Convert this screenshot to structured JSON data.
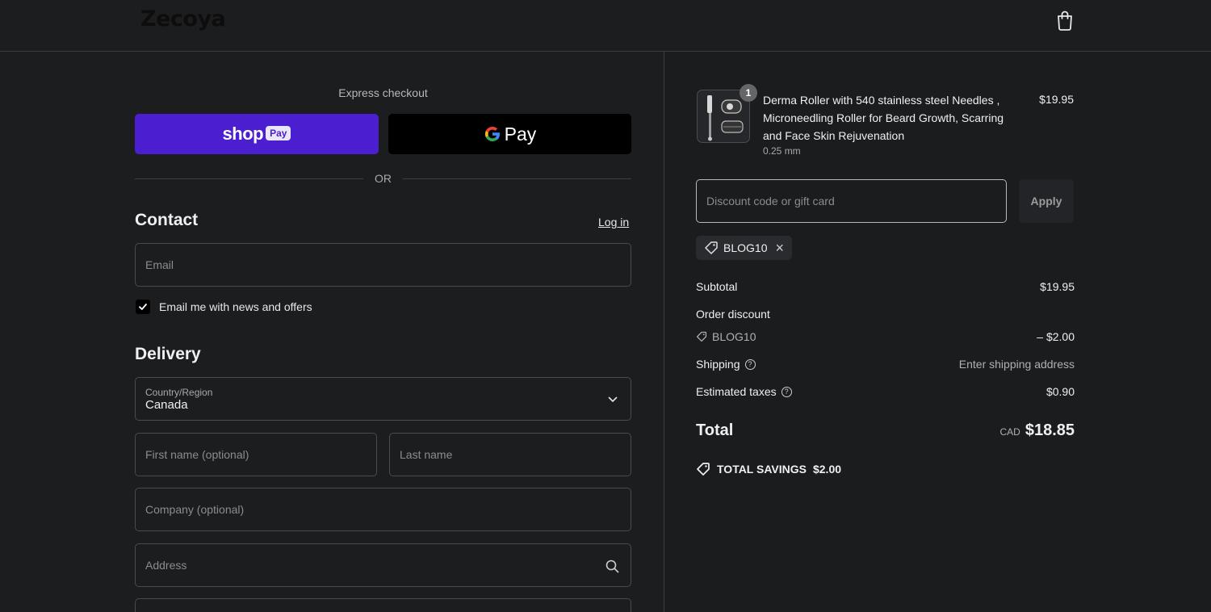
{
  "header": {
    "logo": "Zecoya",
    "cart_icon": "shopping-bag-icon"
  },
  "express": {
    "label": "Express checkout",
    "shop_pay_text": "shop",
    "shop_pay_pill": "Pay",
    "google_pay_text": "Pay",
    "or_text": "OR"
  },
  "contact": {
    "title": "Contact",
    "login_label": "Log in",
    "email_placeholder": "Email",
    "newsletter_label": "Email me with news and offers",
    "newsletter_checked": true
  },
  "delivery": {
    "title": "Delivery",
    "country_label": "Country/Region",
    "country_value": "Canada",
    "first_name_placeholder": "First name (optional)",
    "last_name_placeholder": "Last name",
    "company_placeholder": "Company (optional)",
    "address_placeholder": "Address"
  },
  "cart": {
    "item": {
      "quantity": "1",
      "title": "Derma Roller with 540 stainless steel Needles , Microneedling Roller for Beard Growth, Scarring and Face Skin Rejuvenation",
      "variant": "0.25 mm",
      "price": "$19.95"
    },
    "discount_placeholder": "Discount code or gift card",
    "apply_label": "Apply",
    "applied_code": "BLOG10",
    "subtotal_label": "Subtotal",
    "subtotal_value": "$19.95",
    "order_discount_label": "Order discount",
    "discount_code": "BLOG10",
    "discount_value": "– $2.00",
    "shipping_label": "Shipping",
    "shipping_value": "Enter shipping address",
    "taxes_label": "Estimated taxes",
    "taxes_value": "$0.90",
    "total_label": "Total",
    "total_currency": "CAD",
    "total_value": "$18.85",
    "savings_label": "TOTAL SAVINGS",
    "savings_value": "$2.00"
  },
  "colors": {
    "shop_pay": "#4b1fcf",
    "background": "#1c1d1f",
    "google_pay": "#000000"
  }
}
